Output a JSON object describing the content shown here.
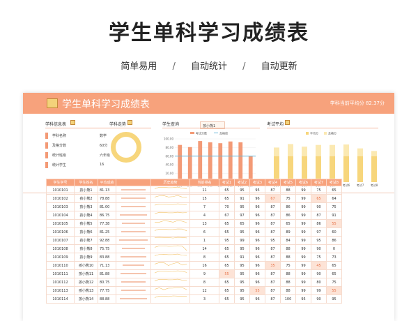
{
  "hero": {
    "title": "学生单科学习成绩表",
    "tags": [
      "简单易用",
      "自动统计",
      "自动更新"
    ],
    "separator": "/"
  },
  "sheet": {
    "banner_title": "学生单科学习成绩表",
    "banner_avg": "学科当前平均分 82.37分",
    "sections": {
      "subject_info": "学科信息表",
      "subject_trend": "学科走势",
      "student_query": "学生查询",
      "student_query_value": "孩小熊1",
      "exam_avg": "考试平均"
    },
    "info_items": [
      {
        "label": "学科名称",
        "value": "数学"
      },
      {
        "label": "及格分数",
        "value": "60分"
      },
      {
        "label": "统计班级",
        "value": "六年级"
      },
      {
        "label": "统计学生",
        "value": "16"
      }
    ],
    "colors": {
      "accent": "#f7a27c",
      "yellow": "#f7d67c"
    }
  },
  "chart_data": [
    {
      "type": "bar",
      "categories": [
        "考试1",
        "考试2",
        "考试3",
        "考试4",
        "考试5",
        "考试6",
        "考试7",
        "考试8"
      ],
      "series": [
        {
          "name": "考试分数",
          "values": [
            86,
            81,
            95,
            92,
            90,
            94,
            92,
            60
          ]
        },
        {
          "name": "及格线",
          "values": [
            60,
            60,
            60,
            60,
            60,
            60,
            60,
            60
          ]
        }
      ],
      "ylim": [
        0,
        100
      ],
      "yticks": [
        "100.00",
        "80.00",
        "60.00",
        "40.00",
        "20.00",
        "0.00"
      ]
    },
    {
      "type": "bar",
      "categories": [
        "考试1",
        "考试2",
        "考试3",
        "考试4",
        "考试5",
        "考试6",
        "考试7",
        "考试8"
      ],
      "series": [
        {
          "name": "平均分",
          "values": [
            80,
            88,
            82,
            86,
            86,
            87,
            78,
            72
          ]
        },
        {
          "name": "及格分",
          "values": [
            60,
            60,
            60,
            60,
            60,
            60,
            60,
            60
          ]
        }
      ],
      "ylim": [
        0,
        100
      ]
    }
  ],
  "table": {
    "headers": [
      "学生学号",
      "学生姓名",
      "平均成绩",
      "",
      "历史趋势",
      "当前排名",
      "考试1",
      "考试2",
      "考试3",
      "考试4",
      "考试5",
      "考试6",
      "考试7",
      "考试8"
    ],
    "rows": [
      [
        "1010101",
        "孩小熊1",
        "81.13",
        "",
        "",
        "11",
        "65",
        "95",
        "95",
        "87",
        "88",
        "99",
        "75",
        "65"
      ],
      [
        "1010102",
        "孩小熊2",
        "78.88",
        "",
        "",
        "15",
        "65",
        "91",
        "96",
        "67",
        "75",
        "99",
        "65",
        "64"
      ],
      [
        "1010103",
        "孩小熊3",
        "81.00",
        "",
        "",
        "7",
        "70",
        "95",
        "96",
        "87",
        "86",
        "99",
        "90",
        "75"
      ],
      [
        "1010104",
        "孩小熊4",
        "86.75",
        "",
        "",
        "4",
        "67",
        "97",
        "96",
        "87",
        "86",
        "99",
        "87",
        "91"
      ],
      [
        "1010105",
        "孩小熊5",
        "77.38",
        "",
        "",
        "13",
        "65",
        "65",
        "96",
        "87",
        "65",
        "99",
        "86",
        "55"
      ],
      [
        "1010106",
        "孩小熊6",
        "81.25",
        "",
        "",
        "6",
        "65",
        "95",
        "96",
        "87",
        "89",
        "99",
        "97",
        "60"
      ],
      [
        "1010107",
        "孩小熊7",
        "92.88",
        "",
        "",
        "1",
        "95",
        "99",
        "96",
        "95",
        "84",
        "99",
        "95",
        "86"
      ],
      [
        "1010108",
        "孩小熊8",
        "75.75",
        "",
        "",
        "14",
        "65",
        "95",
        "96",
        "87",
        "88",
        "99",
        "90",
        "0"
      ],
      [
        "1010109",
        "孩小熊9",
        "83.88",
        "",
        "",
        "8",
        "65",
        "91",
        "96",
        "87",
        "88",
        "99",
        "75",
        "73"
      ],
      [
        "1010110",
        "孩小熊10",
        "71.13",
        "",
        "",
        "16",
        "65",
        "95",
        "96",
        "35",
        "75",
        "99",
        "45",
        "65"
      ],
      [
        "1010111",
        "孩小熊11",
        "81.88",
        "",
        "",
        "9",
        "55",
        "95",
        "96",
        "87",
        "88",
        "99",
        "90",
        "65"
      ],
      [
        "1010112",
        "孩小熊12",
        "80.75",
        "",
        "",
        "8",
        "65",
        "95",
        "96",
        "87",
        "88",
        "99",
        "80",
        "75"
      ],
      [
        "1010113",
        "孩小熊13",
        "77.75",
        "",
        "",
        "12",
        "65",
        "95",
        "55",
        "87",
        "88",
        "99",
        "99",
        "55"
      ],
      [
        "1010114",
        "孩小熊14",
        "88.88",
        "",
        "",
        "3",
        "65",
        "95",
        "96",
        "87",
        "100",
        "95",
        "90",
        "95"
      ]
    ],
    "highlights": [
      [
        1,
        9
      ],
      [
        1,
        12
      ],
      [
        4,
        13
      ],
      [
        9,
        9
      ],
      [
        9,
        12
      ],
      [
        10,
        6
      ],
      [
        12,
        8
      ],
      [
        12,
        13
      ]
    ],
    "avg_fill": [
      0.81,
      0.79,
      0.81,
      0.87,
      0.77,
      0.81,
      0.93,
      0.76,
      0.84,
      0.71,
      0.82,
      0.81,
      0.78,
      0.89
    ]
  }
}
